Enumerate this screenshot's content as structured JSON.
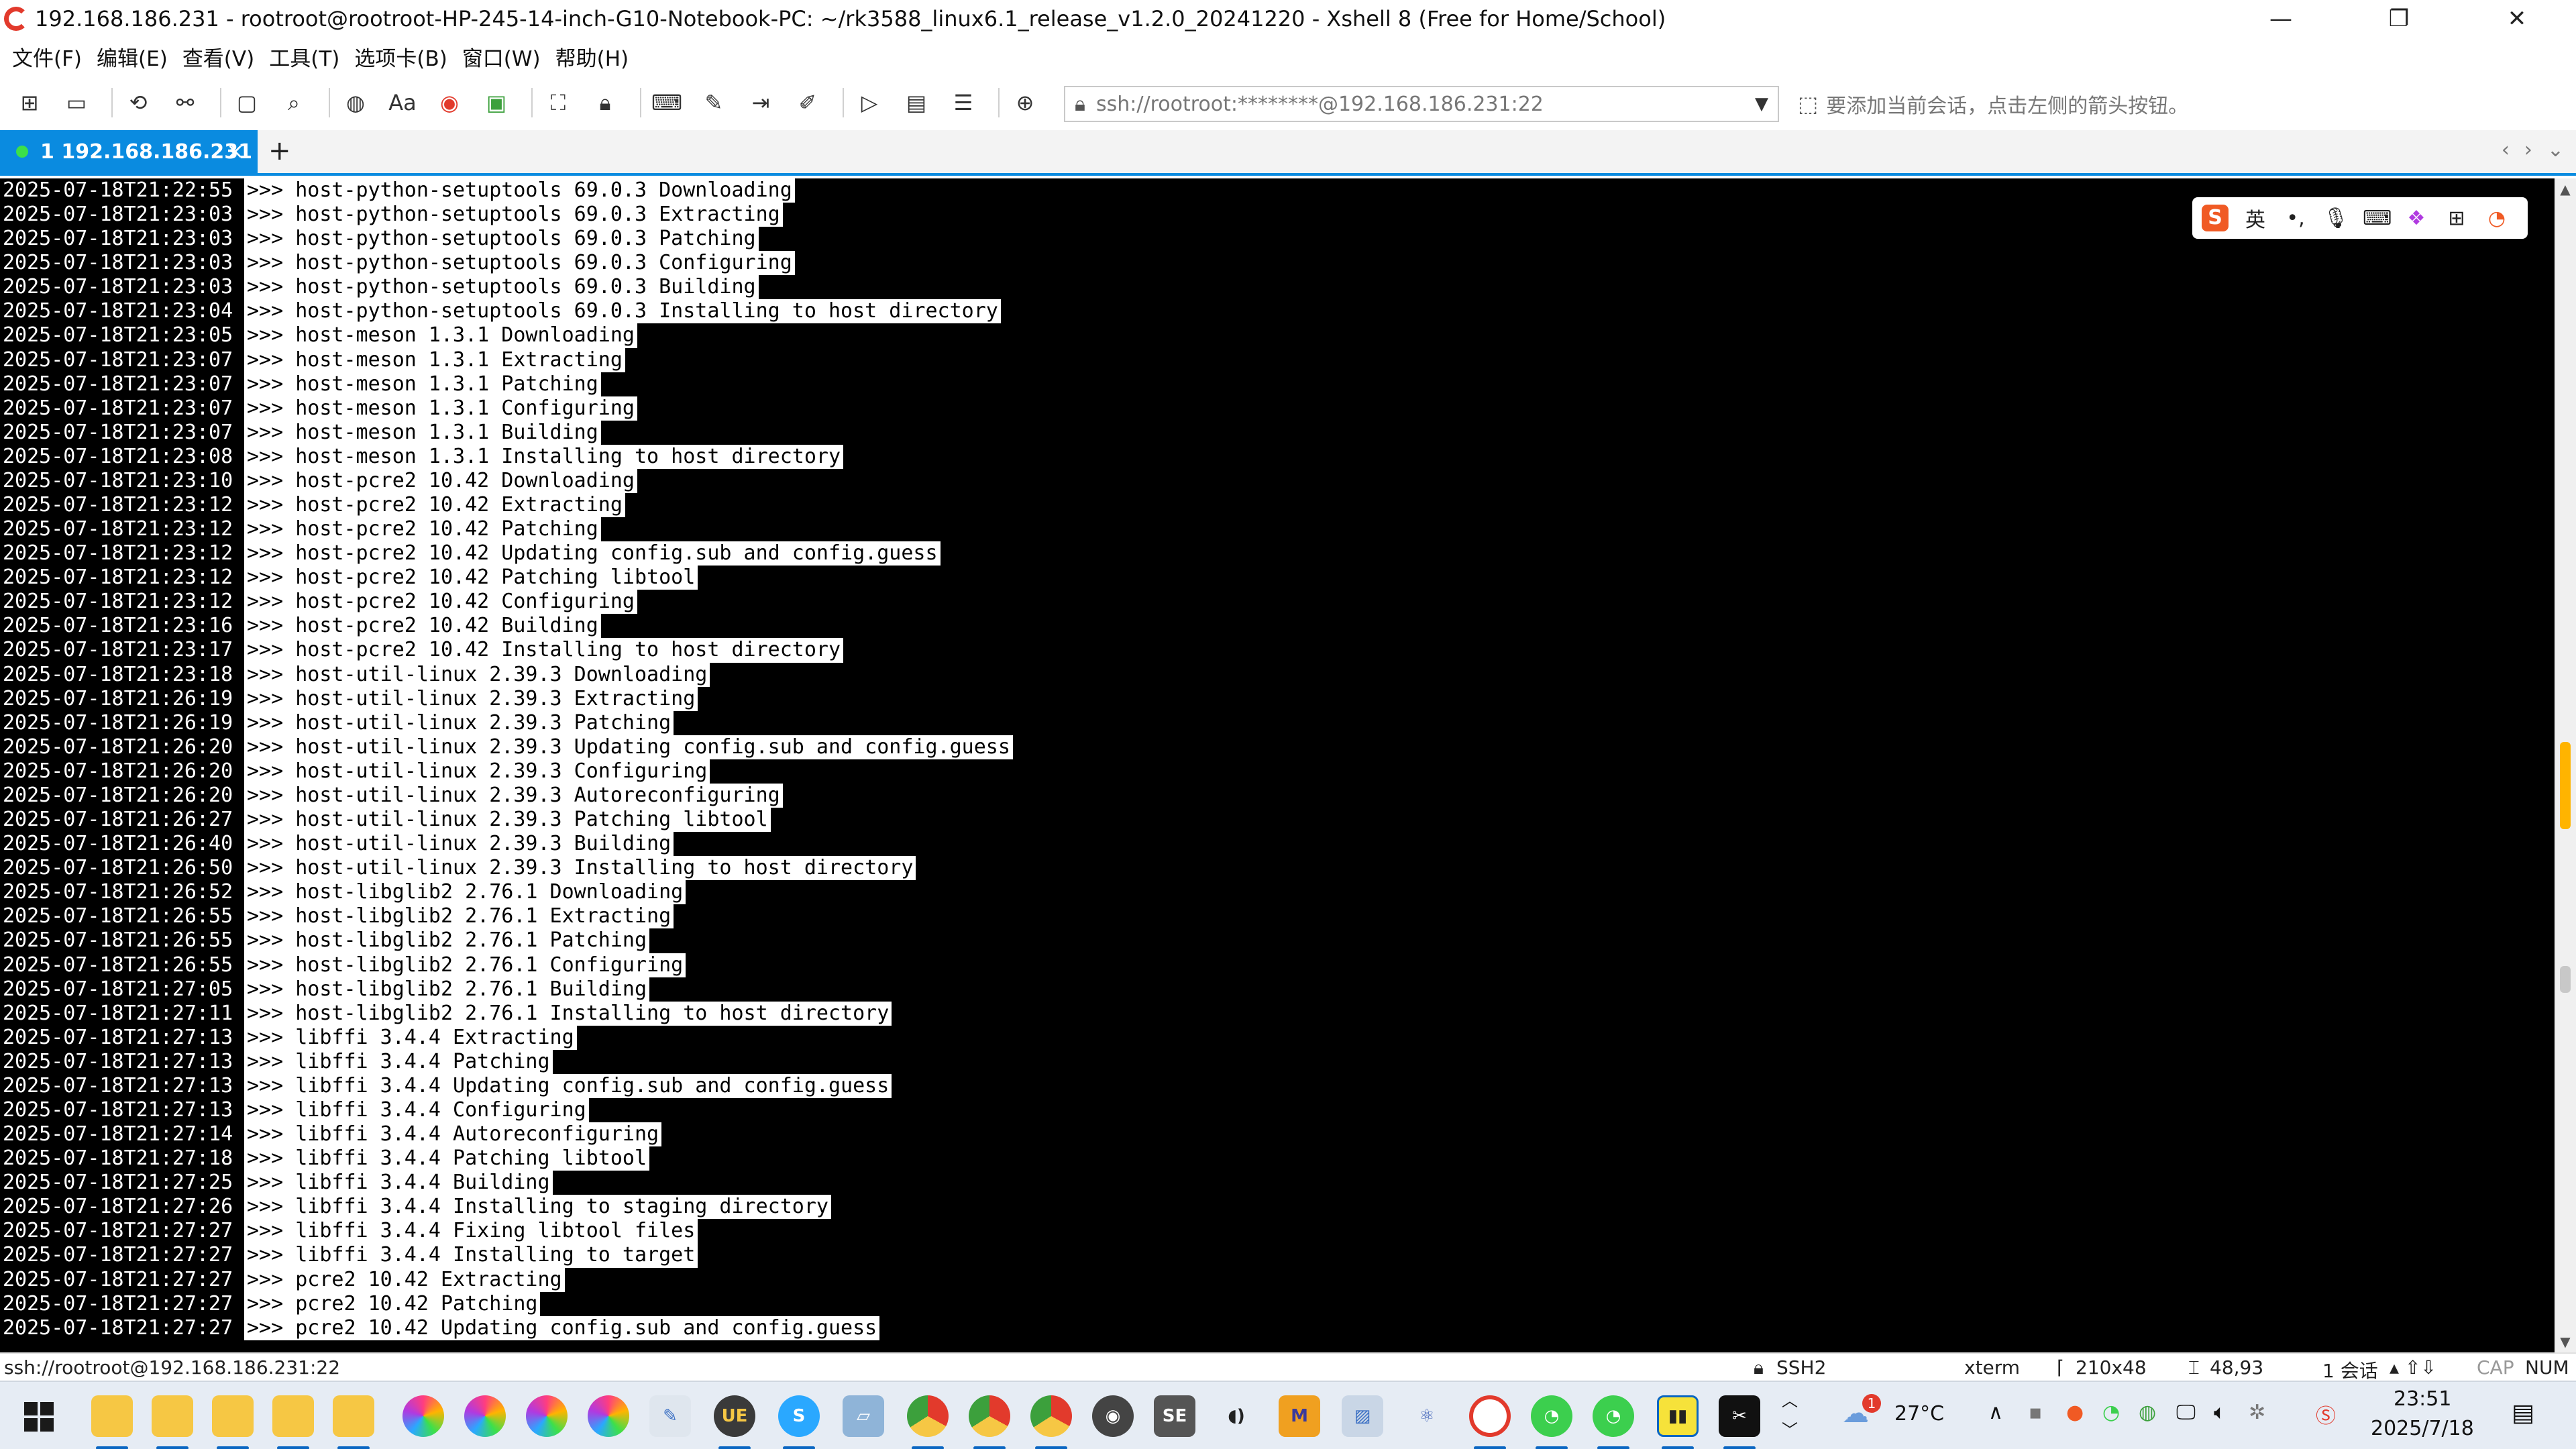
{
  "window": {
    "title": "192.168.186.231 - rootroot@rootroot-HP-245-14-inch-G10-Notebook-PC: ~/rk3588_linux6.1_release_v1.2.0_20241220 - Xshell 8 (Free for Home/School)",
    "minimize": "—",
    "maximize": "❐",
    "close": "✕"
  },
  "menu": [
    "文件(F)",
    "编辑(E)",
    "查看(V)",
    "工具(T)",
    "选项卡(B)",
    "窗口(W)",
    "帮助(H)"
  ],
  "toolbar": {
    "address_url": "ssh://rootroot:********@192.168.186.231:22",
    "address_hint": "要添加当前会话，点击左侧的箭头按钮。"
  },
  "tab": {
    "label": "1 192.168.186.231",
    "close": "×",
    "add": "+",
    "nav_prev": "‹",
    "nav_next": "›",
    "nav_menu": "⌄"
  },
  "ime": {
    "logo": "S",
    "lang": "英",
    "punct": "•,"
  },
  "terminal": {
    "lines": [
      {
        "ts": "2025-07-18T21:22:55",
        "msg": ">>> host-python-setuptools 69.0.3 Downloading"
      },
      {
        "ts": "2025-07-18T21:23:03",
        "msg": ">>> host-python-setuptools 69.0.3 Extracting"
      },
      {
        "ts": "2025-07-18T21:23:03",
        "msg": ">>> host-python-setuptools 69.0.3 Patching"
      },
      {
        "ts": "2025-07-18T21:23:03",
        "msg": ">>> host-python-setuptools 69.0.3 Configuring"
      },
      {
        "ts": "2025-07-18T21:23:03",
        "msg": ">>> host-python-setuptools 69.0.3 Building"
      },
      {
        "ts": "2025-07-18T21:23:04",
        "msg": ">>> host-python-setuptools 69.0.3 Installing to host directory"
      },
      {
        "ts": "2025-07-18T21:23:05",
        "msg": ">>> host-meson 1.3.1 Downloading"
      },
      {
        "ts": "2025-07-18T21:23:07",
        "msg": ">>> host-meson 1.3.1 Extracting"
      },
      {
        "ts": "2025-07-18T21:23:07",
        "msg": ">>> host-meson 1.3.1 Patching"
      },
      {
        "ts": "2025-07-18T21:23:07",
        "msg": ">>> host-meson 1.3.1 Configuring"
      },
      {
        "ts": "2025-07-18T21:23:07",
        "msg": ">>> host-meson 1.3.1 Building"
      },
      {
        "ts": "2025-07-18T21:23:08",
        "msg": ">>> host-meson 1.3.1 Installing to host directory"
      },
      {
        "ts": "2025-07-18T21:23:10",
        "msg": ">>> host-pcre2 10.42 Downloading"
      },
      {
        "ts": "2025-07-18T21:23:12",
        "msg": ">>> host-pcre2 10.42 Extracting"
      },
      {
        "ts": "2025-07-18T21:23:12",
        "msg": ">>> host-pcre2 10.42 Patching"
      },
      {
        "ts": "2025-07-18T21:23:12",
        "msg": ">>> host-pcre2 10.42 Updating config.sub and config.guess"
      },
      {
        "ts": "2025-07-18T21:23:12",
        "msg": ">>> host-pcre2 10.42 Patching libtool"
      },
      {
        "ts": "2025-07-18T21:23:12",
        "msg": ">>> host-pcre2 10.42 Configuring"
      },
      {
        "ts": "2025-07-18T21:23:16",
        "msg": ">>> host-pcre2 10.42 Building"
      },
      {
        "ts": "2025-07-18T21:23:17",
        "msg": ">>> host-pcre2 10.42 Installing to host directory"
      },
      {
        "ts": "2025-07-18T21:23:18",
        "msg": ">>> host-util-linux 2.39.3 Downloading"
      },
      {
        "ts": "2025-07-18T21:26:19",
        "msg": ">>> host-util-linux 2.39.3 Extracting"
      },
      {
        "ts": "2025-07-18T21:26:19",
        "msg": ">>> host-util-linux 2.39.3 Patching"
      },
      {
        "ts": "2025-07-18T21:26:20",
        "msg": ">>> host-util-linux 2.39.3 Updating config.sub and config.guess"
      },
      {
        "ts": "2025-07-18T21:26:20",
        "msg": ">>> host-util-linux 2.39.3 Configuring"
      },
      {
        "ts": "2025-07-18T21:26:20",
        "msg": ">>> host-util-linux 2.39.3 Autoreconfiguring"
      },
      {
        "ts": "2025-07-18T21:26:27",
        "msg": ">>> host-util-linux 2.39.3 Patching libtool"
      },
      {
        "ts": "2025-07-18T21:26:40",
        "msg": ">>> host-util-linux 2.39.3 Building"
      },
      {
        "ts": "2025-07-18T21:26:50",
        "msg": ">>> host-util-linux 2.39.3 Installing to host directory"
      },
      {
        "ts": "2025-07-18T21:26:52",
        "msg": ">>> host-libglib2 2.76.1 Downloading"
      },
      {
        "ts": "2025-07-18T21:26:55",
        "msg": ">>> host-libglib2 2.76.1 Extracting"
      },
      {
        "ts": "2025-07-18T21:26:55",
        "msg": ">>> host-libglib2 2.76.1 Patching"
      },
      {
        "ts": "2025-07-18T21:26:55",
        "msg": ">>> host-libglib2 2.76.1 Configuring"
      },
      {
        "ts": "2025-07-18T21:27:05",
        "msg": ">>> host-libglib2 2.76.1 Building"
      },
      {
        "ts": "2025-07-18T21:27:11",
        "msg": ">>> host-libglib2 2.76.1 Installing to host directory"
      },
      {
        "ts": "2025-07-18T21:27:13",
        "msg": ">>> libffi 3.4.4 Extracting"
      },
      {
        "ts": "2025-07-18T21:27:13",
        "msg": ">>> libffi 3.4.4 Patching"
      },
      {
        "ts": "2025-07-18T21:27:13",
        "msg": ">>> libffi 3.4.4 Updating config.sub and config.guess"
      },
      {
        "ts": "2025-07-18T21:27:13",
        "msg": ">>> libffi 3.4.4 Configuring"
      },
      {
        "ts": "2025-07-18T21:27:14",
        "msg": ">>> libffi 3.4.4 Autoreconfiguring"
      },
      {
        "ts": "2025-07-18T21:27:18",
        "msg": ">>> libffi 3.4.4 Patching libtool"
      },
      {
        "ts": "2025-07-18T21:27:25",
        "msg": ">>> libffi 3.4.4 Building"
      },
      {
        "ts": "2025-07-18T21:27:26",
        "msg": ">>> libffi 3.4.4 Installing to staging directory"
      },
      {
        "ts": "2025-07-18T21:27:27",
        "msg": ">>> libffi 3.4.4 Fixing libtool files"
      },
      {
        "ts": "2025-07-18T21:27:27",
        "msg": ">>> libffi 3.4.4 Installing to target"
      },
      {
        "ts": "2025-07-18T21:27:27",
        "msg": ">>> pcre2 10.42 Extracting"
      },
      {
        "ts": "2025-07-18T21:27:27",
        "msg": ">>> pcre2 10.42 Patching"
      },
      {
        "ts": "2025-07-18T21:27:27",
        "msg": ">>> pcre2 10.42 Updating config.sub and config.guess"
      }
    ]
  },
  "statusbar": {
    "connection": "ssh://rootroot@192.168.186.231:22",
    "protocol": "SSH2",
    "term_type": "xterm",
    "size": "210x48",
    "cursor": "48,93",
    "sessions": "1 会话",
    "cap": "CAP",
    "num": "NUM"
  },
  "taskbar": {
    "weather_temp": "27°C",
    "weather_badge": "1",
    "time": "23:51",
    "date": "2025/7/18"
  },
  "colors": {
    "accent": "#0a8be0",
    "terminal_bg": "#000000",
    "terminal_fg": "#ffffff"
  }
}
